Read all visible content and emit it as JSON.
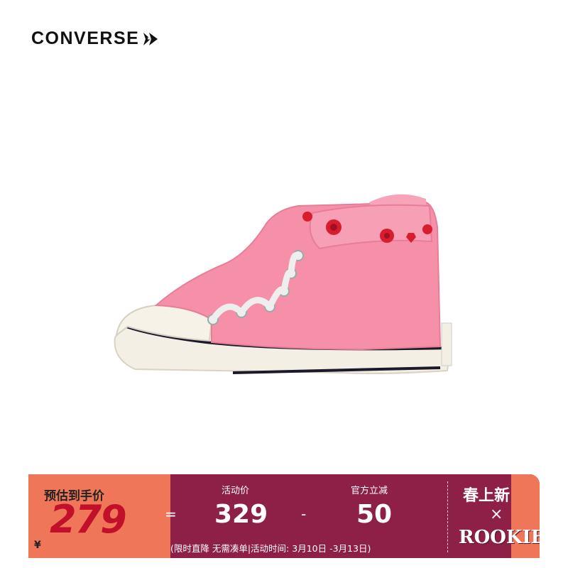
{
  "brand": {
    "name": "CONVERSE"
  },
  "product": {
    "image": "pink-high-top-sneaker-with-rose-embroidery"
  },
  "promo": {
    "estimate_label": "预估到手价",
    "currency": "¥",
    "final_price": "279",
    "equals": "=",
    "activity_price_label": "活动价",
    "activity_price": "329",
    "minus": "-",
    "discount_label": "官方立减",
    "discount": "50",
    "fine_print": "(限时直降 无需凑单|活动时间: 3月10日 -3月13日)",
    "campaign_title": "春上新",
    "campaign_cross": "×",
    "campaign_name": "ROOKIE"
  },
  "colors": {
    "banner": "#8e1f47",
    "promo_left": "#ef7658",
    "price": "#c2102b",
    "shoe": "#f590a8"
  }
}
